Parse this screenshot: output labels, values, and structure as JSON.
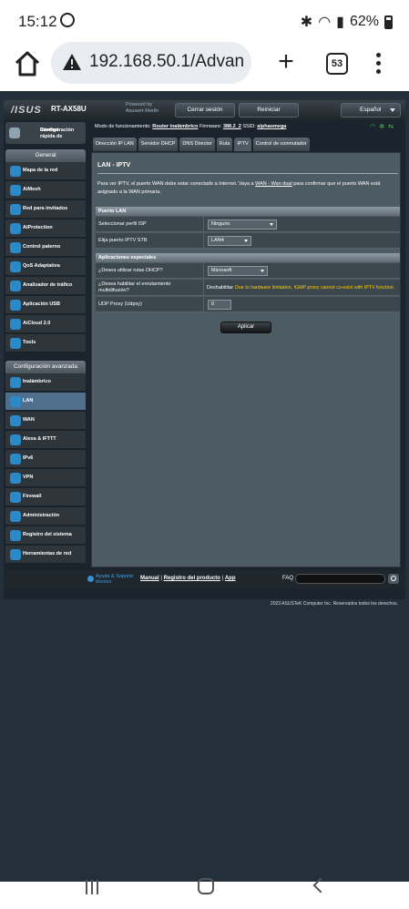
{
  "status_bar": {
    "time": "15:12",
    "battery": "62%"
  },
  "browser": {
    "url": "192.168.50.1/Advan",
    "tab_count": "53"
  },
  "router": {
    "brand": "/ISUS",
    "model": "RT-AX58U",
    "powered_by_line1": "Powered by",
    "powered_by_line2": "Asuswrt-Merlin",
    "logout_label": "Cerrar sesión",
    "reboot_label": "Reiniciar",
    "language": "Español"
  },
  "sidebar": {
    "quick_setup_line1": "Configuración rápida de",
    "quick_setup_line2": "Internet",
    "general_header": "General",
    "general_items": [
      {
        "label": "Mapa de la red"
      },
      {
        "label": "AiMesh"
      },
      {
        "label": "Red para invitados"
      },
      {
        "label": "AiProtection"
      },
      {
        "label": "Control paterno"
      },
      {
        "label": "QoS Adaptativa"
      },
      {
        "label": "Analizador de tráfico"
      },
      {
        "label": "Aplicación USB"
      },
      {
        "label": "AiCloud 2.0"
      },
      {
        "label": "Tools"
      }
    ],
    "advanced_header": "Configuración avanzada",
    "advanced_items": [
      {
        "label": "Inalámbrico"
      },
      {
        "label": "LAN"
      },
      {
        "label": "WAN"
      },
      {
        "label": "Alexa & IFTTT"
      },
      {
        "label": "IPv6"
      },
      {
        "label": "VPN"
      },
      {
        "label": "Firewall"
      },
      {
        "label": "Administración"
      },
      {
        "label": "Registro del sistema"
      },
      {
        "label": "Herramientas de red"
      }
    ]
  },
  "info": {
    "mode_label": "Modo de funcionamiento:",
    "mode_value": "Router inalámbrico",
    "firmware_label": "Firmware:",
    "firmware_value": "388.2_2",
    "ssid_label": "SSID:",
    "ssid_value": "alphaomega"
  },
  "tabs": [
    {
      "label": "Dirección IP LAN"
    },
    {
      "label": "Servidor DHCP"
    },
    {
      "label": "DNS Director"
    },
    {
      "label": "Ruta"
    },
    {
      "label": "IPTV"
    },
    {
      "label": "Control de conmutador"
    }
  ],
  "page": {
    "title": "LAN - IPTV",
    "desc_part1": "Para ver IPTV, el puerto WAN debe estar conectado a Internet. Vaya a ",
    "desc_link": "WAN - Wan dual",
    "desc_part2": " para confirmar que el puerto WAN está asignado a la WAN primaria.",
    "lan_port_header": "Puerto LAN",
    "isp_profile_label": "Seleccionar perfil ISP",
    "isp_profile_value": "Ninguno",
    "iptv_port_label": "Elija puerto IPTV STB",
    "iptv_port_value": "LAN4",
    "special_header": "Aplicaciones especiales",
    "dhcp_routes_label": "¿Desea utilizar rutas DHCP?",
    "dhcp_routes_value": "Microsoft",
    "multicast_label_line1": "¿Desea habilitar el enrutamiento",
    "multicast_label_line2": "multidifusión?",
    "multicast_value": "Deshabilitar",
    "multicast_note": "Due to hardware limitation, IGMP proxy cannot co-exist with IPTV function.",
    "udpxy_label": "UDP Proxy (Udpxy)",
    "udpxy_value": "0",
    "apply_label": "Aplicar"
  },
  "footer": {
    "help_line1": "Ayuda & Soporte",
    "help_line2": "técnico",
    "manual": "Manual",
    "product_registration": "Registro del producto",
    "app": "App",
    "faq": "FAQ",
    "copyright": "2023 ASUSTeK Computer Inc. Reservados todos los derechos."
  }
}
